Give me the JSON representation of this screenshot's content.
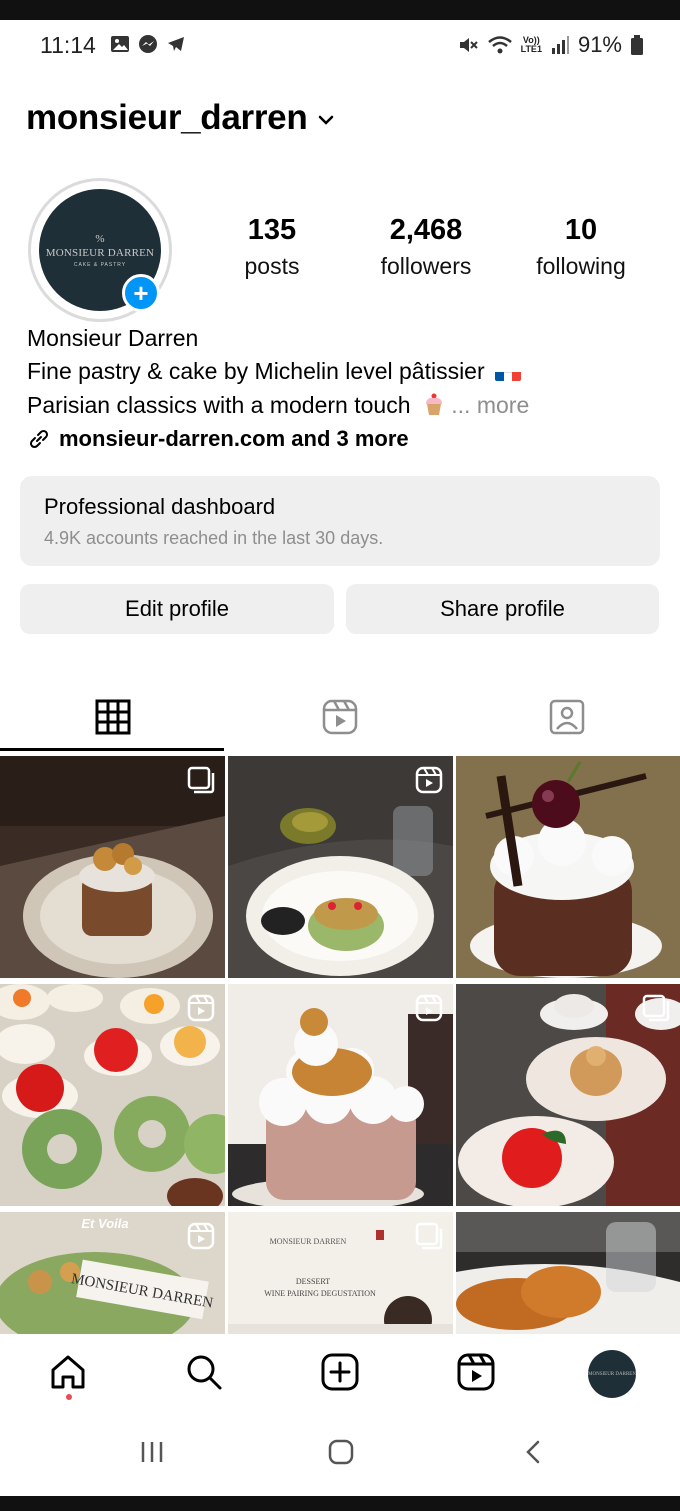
{
  "status_bar": {
    "time": "11:14",
    "left_icons": [
      "gallery-icon",
      "messenger-icon",
      "telegram-icon"
    ],
    "right_icons": [
      "mute-icon",
      "wifi-icon",
      "volte-icon",
      "signal-icon",
      "battery-icon"
    ],
    "volte_top": "Vo))",
    "volte_bottom": "LTE1",
    "battery": "91%"
  },
  "profile": {
    "username": "monsieur_darren",
    "avatar": {
      "symbol": "%",
      "brand": "MONSIEUR DARREN",
      "sub": "CAKE & PASTRY"
    },
    "stats": [
      {
        "value": "135",
        "label": "posts"
      },
      {
        "value": "2,468",
        "label": "followers"
      },
      {
        "value": "10",
        "label": "following"
      }
    ],
    "display_name": "Monsieur Darren",
    "bio_line1": "Fine pastry & cake by Michelin level pâtissier",
    "bio_line2": "Parisian classics with a modern touch",
    "more_label": "... more",
    "link": "monsieur-darren.com and 3 more"
  },
  "dashboard": {
    "title": "Professional dashboard",
    "subtitle": "4.9K accounts reached in the last 30 days."
  },
  "buttons": {
    "edit": "Edit profile",
    "share": "Share profile"
  },
  "tabs": [
    "grid-icon",
    "reels-icon",
    "tagged-icon"
  ],
  "grid_overlays": {
    "post7_caption": "Et Voila",
    "post7_card": "MONSIEUR DARREN",
    "post8_brand": "MONSIEUR DARREN",
    "post8_line1": "DESSERT",
    "post8_line2": "WINE PAIRING DEGUSTATION"
  },
  "bottom_nav": [
    "home-icon",
    "search-icon",
    "create-icon",
    "reels-icon",
    "profile-avatar"
  ],
  "colors": {
    "accent": "#0095f6",
    "button_bg": "#efefef",
    "muted": "#8e8e8e",
    "notification": "#ed4956"
  }
}
